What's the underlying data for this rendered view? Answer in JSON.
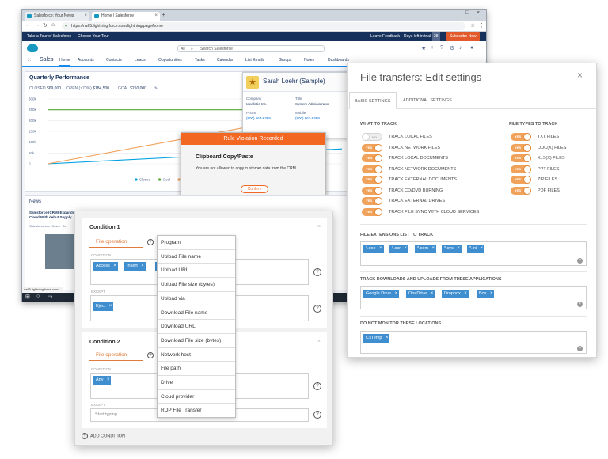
{
  "browser": {
    "tabs": [
      "Salesforce: Your News",
      "Home | Salesforce"
    ],
    "url": "https://na65.lightning.force.com/lightning/page/home",
    "banner": {
      "left1": "Take a Tour of Salesforce",
      "left2": "Choose Your Tour",
      "feedback": "Leave Feedback",
      "trial": "Days left in trial",
      "trial_days": "28",
      "subscribe": "Subscribe Now"
    },
    "search": {
      "scope": "All",
      "placeholder": "Search Salesforce"
    },
    "app_name": "Sales",
    "nav": [
      "Home",
      "Accounts",
      "Contacts",
      "Leads",
      "Opportunities",
      "Tasks",
      "Calendar",
      "List Emails",
      "Groups",
      "Notes",
      "Dashboards"
    ]
  },
  "chart": {
    "title": "Quarterly Performance",
    "closed_label": "CLOSED",
    "closed_value": "$69,000",
    "open_label": "OPEN (>70%)",
    "open_value": "$184,500",
    "goal_label": "GOAL",
    "goal_value": "$250,000",
    "legend": [
      "Closed",
      "Goal",
      "Closed + Open (>70%)"
    ]
  },
  "chart_data": {
    "type": "line",
    "y_ticks": [
      "300k",
      "250k",
      "200k",
      "150k",
      "100k",
      "50k",
      "0"
    ],
    "ylim": [
      0,
      300000
    ],
    "series": [
      {
        "name": "Closed",
        "values": [
          0,
          69000
        ],
        "color": "#00a1e0"
      },
      {
        "name": "Goal",
        "values": [
          250000,
          250000
        ],
        "color": "#54a830"
      },
      {
        "name": "Closed + Open (>70%)",
        "values": [
          0,
          250000
        ],
        "color": "#f0a25a"
      }
    ]
  },
  "contact": {
    "name": "Sarah Loehr (Sample)",
    "company_label": "Company",
    "company": "Idealistic Inc.",
    "title_label": "Title",
    "title": "System Administrator",
    "phone_label": "Phone",
    "phone": "(800) 667-6389",
    "mobile_label": "Mobile",
    "mobile": "(800) 667-6389"
  },
  "rule": {
    "header": "Rule Violation Recorded",
    "title": "Clipboard Copy/Paste",
    "message": "You are not allowed to copy customer data from the CRM.",
    "confirm": "Confirm"
  },
  "news": {
    "title": "News",
    "headline": "Salesforce (CRM) Expands Cloud With debut Supply",
    "source": "Salesforce.com News · 3w"
  },
  "status_url": "na65.lightning.force.com/...",
  "ft": {
    "title": "File transfers: Edit settings",
    "tabs": [
      "BASIC SETTINGS",
      "ADDITIONAL SETTINGS"
    ],
    "what_header": "WHAT TO TRACK",
    "types_header": "FILE TYPES TO TRACK",
    "track": [
      {
        "label": "TRACK LOCAL FILES",
        "state": "NO"
      },
      {
        "label": "TRACK NETWORK FILES",
        "state": "YES"
      },
      {
        "label": "TRACK LOCAL DOCUMENTS",
        "state": "YES"
      },
      {
        "label": "TRACK NETWORK DOCUMENTS",
        "state": "YES"
      },
      {
        "label": "TRACK EXTERNAL DOCUMENTS",
        "state": "YES"
      },
      {
        "label": "TRACK CD/DVD BURNING",
        "state": "YES"
      },
      {
        "label": "TRACK EXTERNAL DRIVES",
        "state": "YES"
      },
      {
        "label": "TRACK FILE SYNC WITH CLOUD SERVICES",
        "state": "YES"
      }
    ],
    "types": [
      {
        "label": "TXT FILES",
        "state": "YES"
      },
      {
        "label": "DOC(X) FILES",
        "state": "YES"
      },
      {
        "label": "XLS(X) FILES",
        "state": "YES"
      },
      {
        "label": "PPT FILES",
        "state": "YES"
      },
      {
        "label": "ZIP FILES",
        "state": "YES"
      },
      {
        "label": "PDF FILES",
        "state": "YES"
      }
    ],
    "ext_header": "FILE EXTENSIONS LIST TO TRACK",
    "extensions": [
      "*.exe",
      "*.scr",
      "*.com",
      "*.sys",
      "*.ini"
    ],
    "apps_header": "TRACK DOWNLOADS AND UPLOADS FROM THESE APPLICATIONS",
    "apps": [
      "Google Drive",
      "OneDrive",
      "Dropbox",
      "Box"
    ],
    "locations_header": "DO NOT MONITOR THESE LOCATIONS",
    "locations": [
      "C:\\Temp"
    ]
  },
  "conditions": {
    "c1": {
      "title": "Condition 1",
      "field": "File operation",
      "cond_label": "CONDITION",
      "chips": [
        "Access",
        "Insert",
        "C"
      ],
      "except_label": "EXCEPT",
      "except_chips": [
        "Eject"
      ]
    },
    "c2": {
      "title": "Condition 2",
      "field": "File operation",
      "cond_label": "CONDITION",
      "chips": [
        "Any"
      ],
      "except_label": "EXCEPT",
      "except_placeholder": "Start typing..."
    },
    "add": "ADD CONDITION"
  },
  "dropdown": [
    "Program",
    "Upload File name",
    "Upload URL",
    "Upload File size (bytes)",
    "Upload via",
    "Download File name",
    "Download URL",
    "Download File size (bytes)",
    "Network host",
    "File path",
    "Drive",
    "Cloud provider",
    "RDP File Transfer"
  ]
}
